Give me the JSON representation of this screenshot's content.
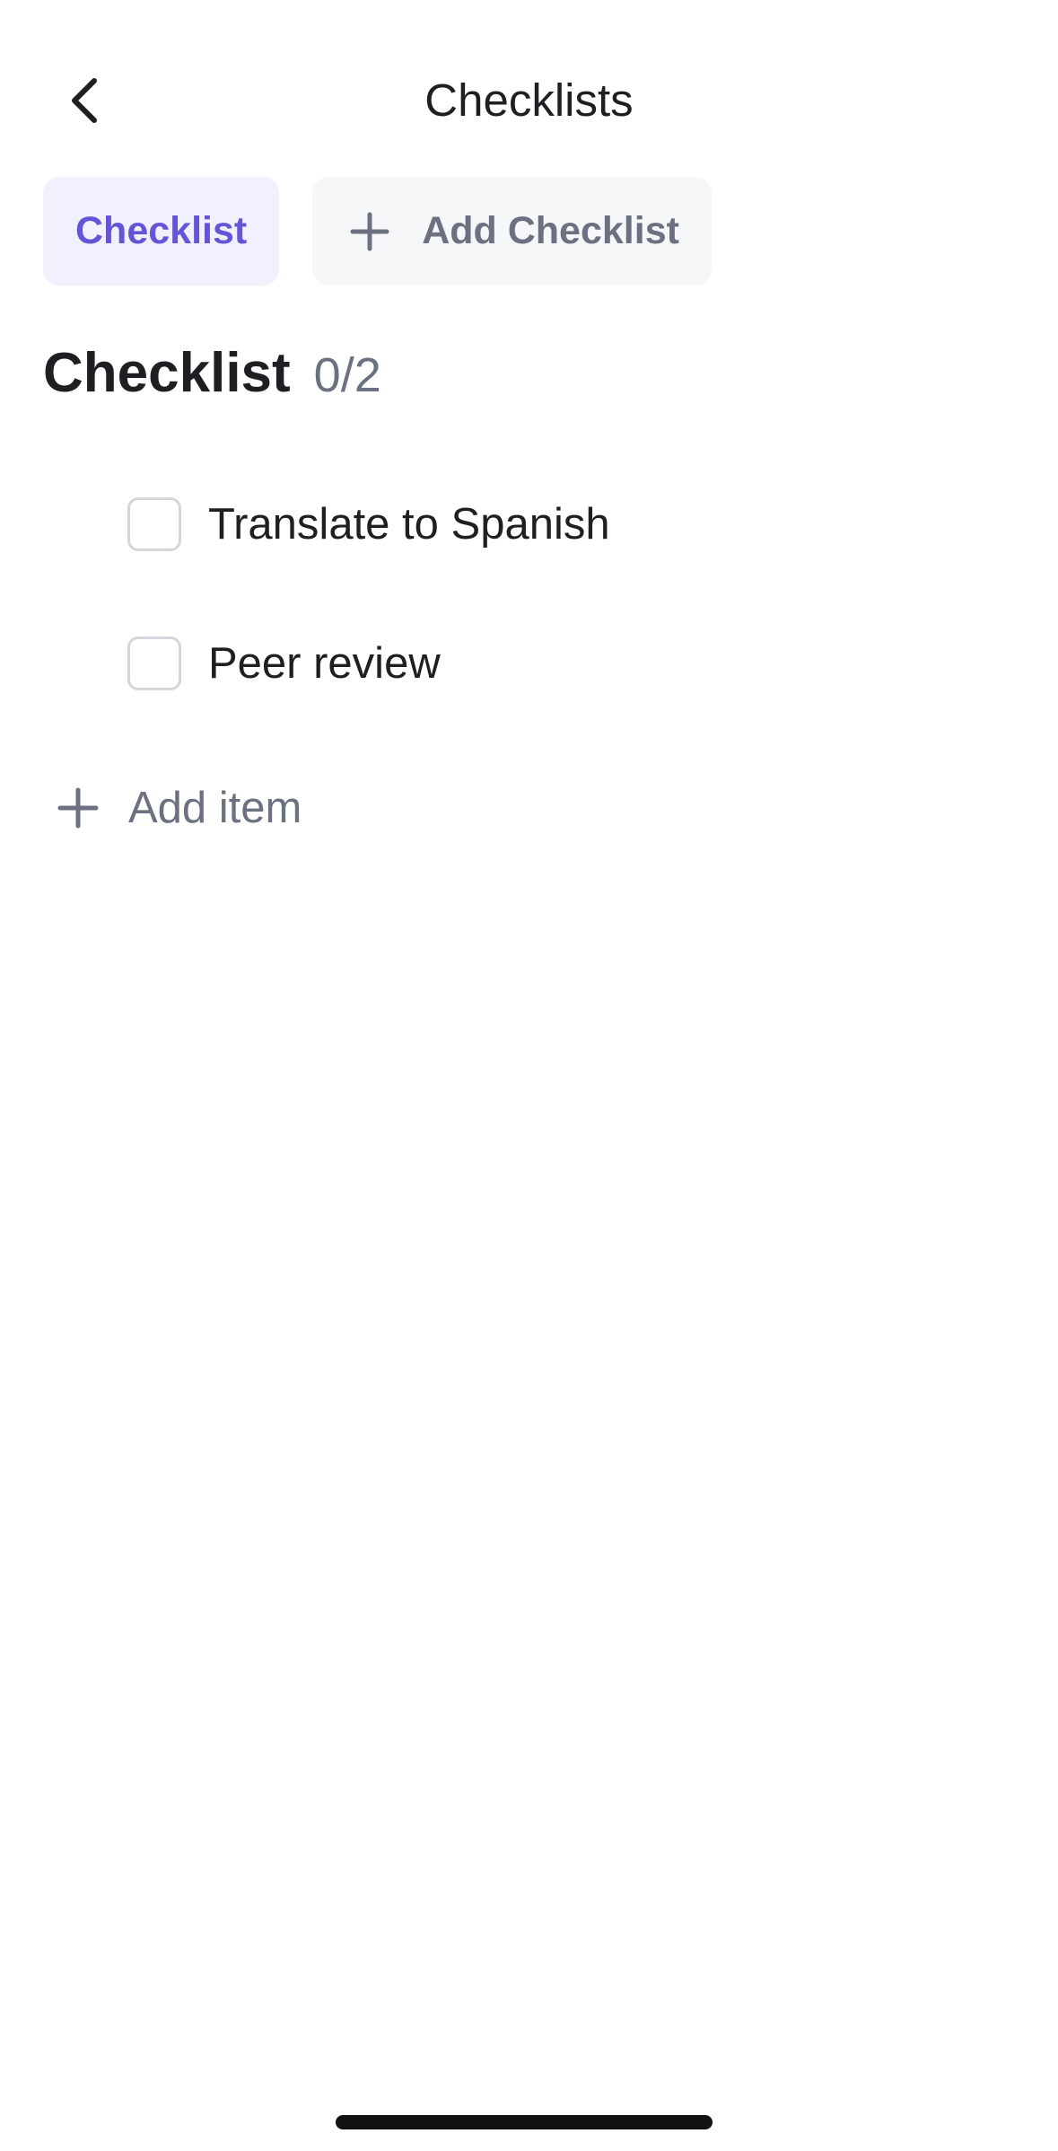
{
  "header": {
    "title": "Checklists",
    "back_icon": "chevron-left-icon"
  },
  "tabs": [
    {
      "label": "Checklist",
      "active": true
    },
    {
      "label": "Add Checklist",
      "icon": "plus-icon",
      "active": false
    }
  ],
  "checklist": {
    "title": "Checklist",
    "count": "0/2",
    "items": [
      {
        "label": "Translate to Spanish",
        "checked": false
      },
      {
        "label": "Peer review",
        "checked": false
      }
    ],
    "add_item_label": "Add item",
    "add_item_icon": "plus-icon"
  },
  "colors": {
    "accent": "#6455d6",
    "accent_bg": "#f1f0fd",
    "muted_text": "#6b7180",
    "secondary_bg": "#f6f7f9",
    "checkbox_border": "#d4d6db"
  }
}
